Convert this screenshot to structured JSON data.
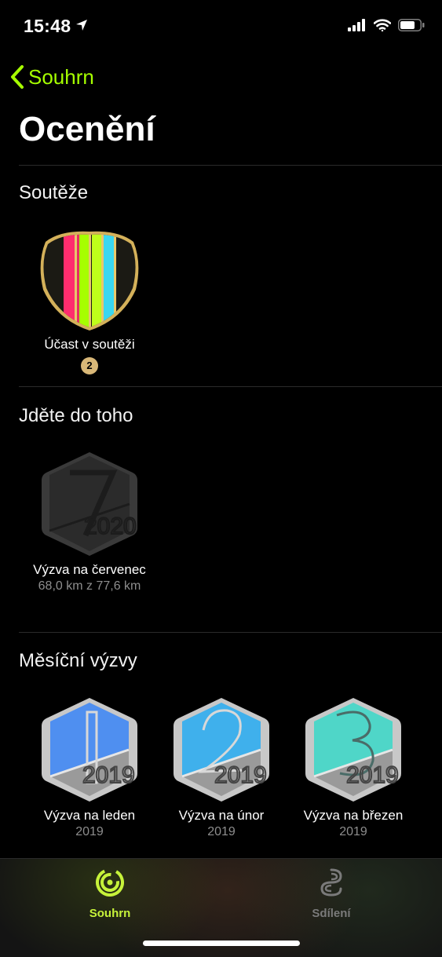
{
  "status": {
    "time": "15:48"
  },
  "nav": {
    "back_label": "Souhrn"
  },
  "page": {
    "title": "Ocenění"
  },
  "sections": {
    "competitions": {
      "title": "Soutěže",
      "awards": [
        {
          "name": "Účast v soutěži",
          "count": "2"
        }
      ]
    },
    "go_for_it": {
      "title": "Jděte do toho",
      "awards": [
        {
          "name": "Výzva na červenec",
          "progress": "68,0 km z 77,6 km"
        }
      ]
    },
    "monthly": {
      "title": "Měsíční výzvy",
      "awards": [
        {
          "name": "Výzva na leden",
          "year": "2019",
          "digit": "1"
        },
        {
          "name": "Výzva na únor",
          "year": "2019",
          "digit": "2"
        },
        {
          "name": "Výzva na březen",
          "year": "2019",
          "digit": "3"
        }
      ]
    }
  },
  "tabs": [
    {
      "label": "Souhrn",
      "icon": "activity-rings-icon",
      "active": true
    },
    {
      "label": "Sdílení",
      "icon": "sharing-icon",
      "active": false
    }
  ],
  "colors": {
    "accent": "#a6ff00",
    "tab_active": "#c6f23a"
  }
}
